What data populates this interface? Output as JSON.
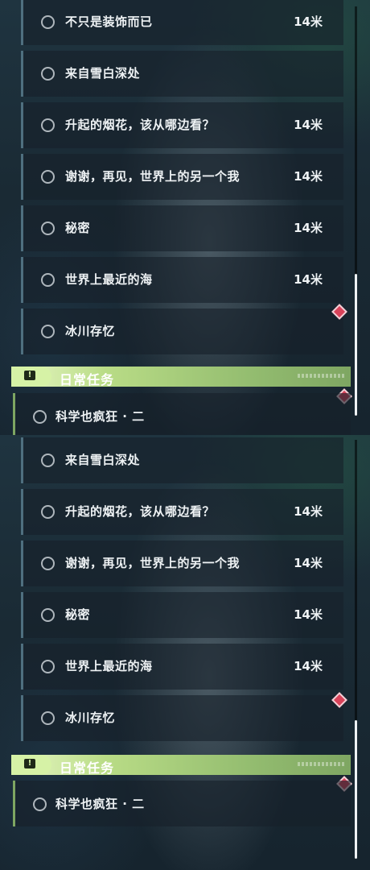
{
  "screens": [
    {
      "quests": [
        {
          "title": "不只是装饰而已",
          "distance": "14米"
        },
        {
          "title": "来自雪白深处",
          "distance": ""
        },
        {
          "title": "升起的烟花，该从哪边看？",
          "distance": "14米"
        },
        {
          "title": "谢谢，再见，世界上的另一个我",
          "distance": "14米"
        },
        {
          "title": "秘密",
          "distance": "14米"
        },
        {
          "title": "世界上最近的海",
          "distance": "14米"
        },
        {
          "title": "冰川存忆",
          "distance": ""
        }
      ],
      "section": {
        "title": "日常任务",
        "icon": "exclamation-icon"
      },
      "daily_quests": [
        {
          "title": "科学也疯狂 · 二",
          "distance": ""
        }
      ]
    },
    {
      "quests": [
        {
          "title": "来自雪白深处",
          "distance": ""
        },
        {
          "title": "升起的烟花，该从哪边看？",
          "distance": "14米"
        },
        {
          "title": "谢谢，再见，世界上的另一个我",
          "distance": "14米"
        },
        {
          "title": "秘密",
          "distance": "14米"
        },
        {
          "title": "世界上最近的海",
          "distance": "14米"
        },
        {
          "title": "冰川存忆",
          "distance": ""
        }
      ],
      "section": {
        "title": "日常任务",
        "icon": "exclamation-icon"
      },
      "daily_quests": [
        {
          "title": "科学也疯狂 · 二",
          "distance": ""
        }
      ]
    }
  ],
  "colors": {
    "section_accent": "#b9dc86",
    "tracked_marker": "#d9435a"
  }
}
